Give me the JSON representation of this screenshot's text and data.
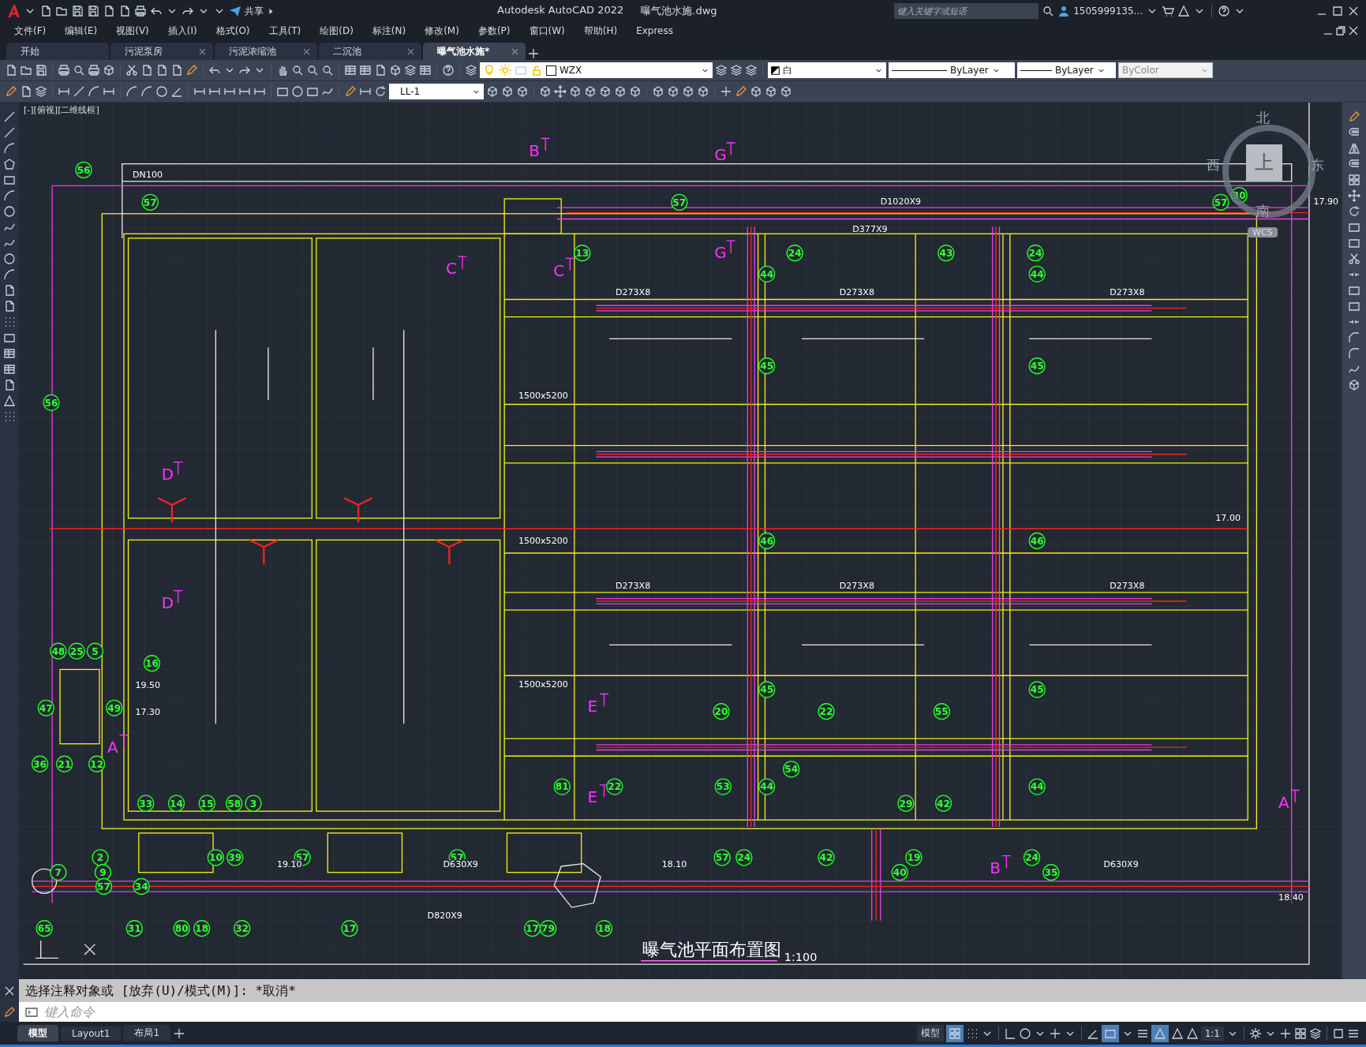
{
  "title_bar": {
    "app_title": "Autodesk AutoCAD 2022",
    "file_name": "曝气池水施.dwg",
    "share_label": "共享",
    "search": {
      "placeholder": "键入关键字或短语"
    },
    "user_name": "1505999135..."
  },
  "menu": [
    "文件(F)",
    "编辑(E)",
    "视图(V)",
    "插入(I)",
    "格式(O)",
    "工具(T)",
    "绘图(D)",
    "标注(N)",
    "修改(M)",
    "参数(P)",
    "窗口(W)",
    "帮助(H)",
    "Express"
  ],
  "file_tabs": [
    {
      "label": "开始",
      "selected": false,
      "closable": false
    },
    {
      "label": "污泥泵房",
      "selected": false,
      "closable": true
    },
    {
      "label": "污泥浓缩池",
      "selected": false,
      "closable": true
    },
    {
      "label": "二沉池",
      "selected": false,
      "closable": true
    },
    {
      "label": "曝气池水施*",
      "selected": true,
      "closable": true
    }
  ],
  "properties": {
    "layer": "WZX",
    "color_setting": "白",
    "linetype": "ByLayer",
    "lineweight": "ByLayer",
    "plot_style": "ByColor",
    "dim_style": "LL-1"
  },
  "viewport_label": "[-][俯视][二维线框]",
  "viewcube": {
    "north": "北",
    "south": "南",
    "east": "东",
    "west": "西",
    "face": "上",
    "ucs": "WCS"
  },
  "drawing": {
    "title": "曝气池平面布置图",
    "scale": "1:100",
    "section_markers": [
      "B",
      "G",
      "G",
      "C",
      "C",
      "D",
      "D",
      "E",
      "E",
      "A",
      "A",
      "B"
    ],
    "callouts": [
      "56",
      "57",
      "57",
      "57",
      "30",
      "13",
      "24",
      "43",
      "24",
      "44",
      "44",
      "45",
      "45",
      "56",
      "46",
      "46",
      "48",
      "25",
      "5",
      "16",
      "45",
      "45",
      "47",
      "49",
      "20",
      "22",
      "55",
      "36",
      "21",
      "12",
      "54",
      "81",
      "22",
      "53",
      "44",
      "44",
      "33",
      "14",
      "15",
      "58",
      "3",
      "29",
      "42",
      "2",
      "10",
      "39",
      "57",
      "57",
      "57",
      "24",
      "42",
      "19",
      "24",
      "7",
      "9",
      "40",
      "35",
      "57",
      "34",
      "65",
      "31",
      "80",
      "18",
      "32",
      "17",
      "17",
      "79",
      "18"
    ],
    "labels": [
      "DN100",
      "D1020X9",
      "17.90",
      "D377X9",
      "D273X8",
      "D273X8",
      "D273X8",
      "1500x5200",
      "17.00",
      "1500x5200",
      "D273X8",
      "D273X8",
      "D273X8",
      "19.50",
      "1500x5200",
      "17.30",
      "19.10",
      "D630X9",
      "18.10",
      "D630X9",
      "18.40",
      "D820X9"
    ]
  },
  "command": {
    "history": "选择注释对象或 [放弃(U)/模式(M)]: *取消*",
    "placeholder": "键入命令"
  },
  "layout_tabs": [
    {
      "label": "模型",
      "selected": true
    },
    {
      "label": "Layout1",
      "selected": false
    },
    {
      "label": "布局1",
      "selected": false
    }
  ],
  "status_bar": {
    "space": "模型",
    "annotation_scale": "1:1"
  }
}
